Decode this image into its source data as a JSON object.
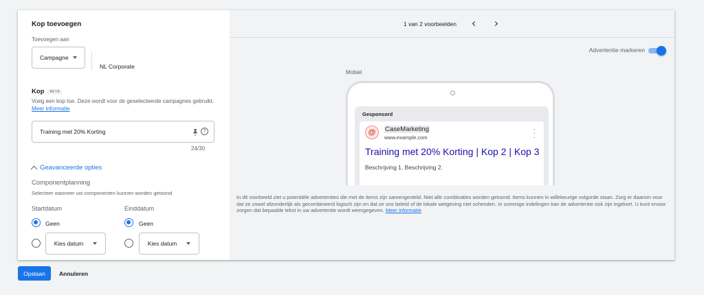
{
  "form": {
    "title": "Kop toevoegen",
    "add_to_label": "Toevoegen aan",
    "scope_select": "Campagne",
    "campaign_name": "NL Corporate",
    "headline_section_title": "Kop",
    "beta_badge": "BÈTA",
    "headline_desc": "Voeg een kop toe. Deze wordt voor de geselecteerde campagnes gebruikt.",
    "more_info_link": "Meer informatie",
    "headline_value": "Training met 20% Korting",
    "char_counter": "24/30",
    "advanced_options": "Geavanceerde opties",
    "component_planning_title": "Componentplanning",
    "component_planning_desc": "Selecteer wanneer uw componenten kunnen worden getoond",
    "start": {
      "label": "Startdatum",
      "option_none": "Geen",
      "option_pick": "Kies datum"
    },
    "end": {
      "label": "Einddatum",
      "option_none": "Geen",
      "option_pick": "Kies datum"
    }
  },
  "preview": {
    "pager_text": "1 van 2 voorbeelden",
    "highlight_toggle_label": "Advertentie markeren",
    "highlight_on": true,
    "device_label": "Mobiel",
    "sponsored_label": "Gesponsord",
    "advertiser_name": "CaseMarketing",
    "display_url": "www.example.com",
    "headline": "Training met 20% Korting | Kop 2 | Kop 3",
    "description": "Beschrijving 1. Beschrijving 2.",
    "disclaimer": "In dit voorbeeld ziet u potentiële advertenties die met de items zijn samengesteld. Niet alle combinaties worden getoond. Items kunnen in willekeurige volgorde staan. Zorg er daarom voor dat ze zowel afzonderlijk als gecombineerd logisch zijn en dat ze ons beleid of de lokale wetgeving niet schenden. In sommige indelingen kan de advertentie ook zijn ingekort. U kunt ervoor zorgen dat bepaalde tekst in uw advertentie wordt weergegeven.",
    "disclaimer_link": "Meer informatie"
  },
  "actions": {
    "save": "Opslaan",
    "cancel": "Annuleren"
  },
  "colors": {
    "accent": "#1a73e8",
    "ad_headline": "#1a0dab"
  }
}
